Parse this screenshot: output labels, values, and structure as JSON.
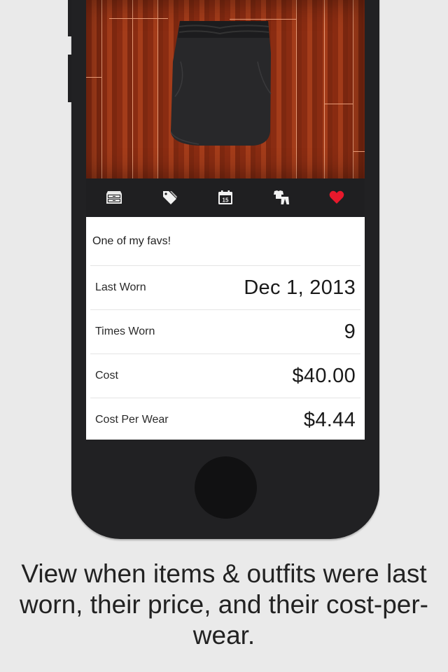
{
  "toolbar": {
    "icons": [
      {
        "name": "drawer-icon",
        "label": "Drawers"
      },
      {
        "name": "tag-icon",
        "label": "Tags"
      },
      {
        "name": "calendar-icon",
        "label": "Calendar",
        "text": "15"
      },
      {
        "name": "outfit-icon",
        "label": "Outfits"
      },
      {
        "name": "heart-icon",
        "label": "Favorite",
        "color": "#e8192c"
      }
    ]
  },
  "item": {
    "note": "One of my favs!",
    "details": [
      {
        "label": "Last Worn",
        "value": "Dec 1, 2013"
      },
      {
        "label": "Times Worn",
        "value": "9"
      },
      {
        "label": "Cost",
        "value": "$40.00"
      },
      {
        "label": "Cost Per Wear",
        "value": "$4.44"
      }
    ]
  },
  "caption": "View when items & outfits were last worn, their price, and their cost-per-wear.",
  "colors": {
    "background": "#eaeaea",
    "phone": "#212123",
    "accent_heart": "#e8192c"
  }
}
